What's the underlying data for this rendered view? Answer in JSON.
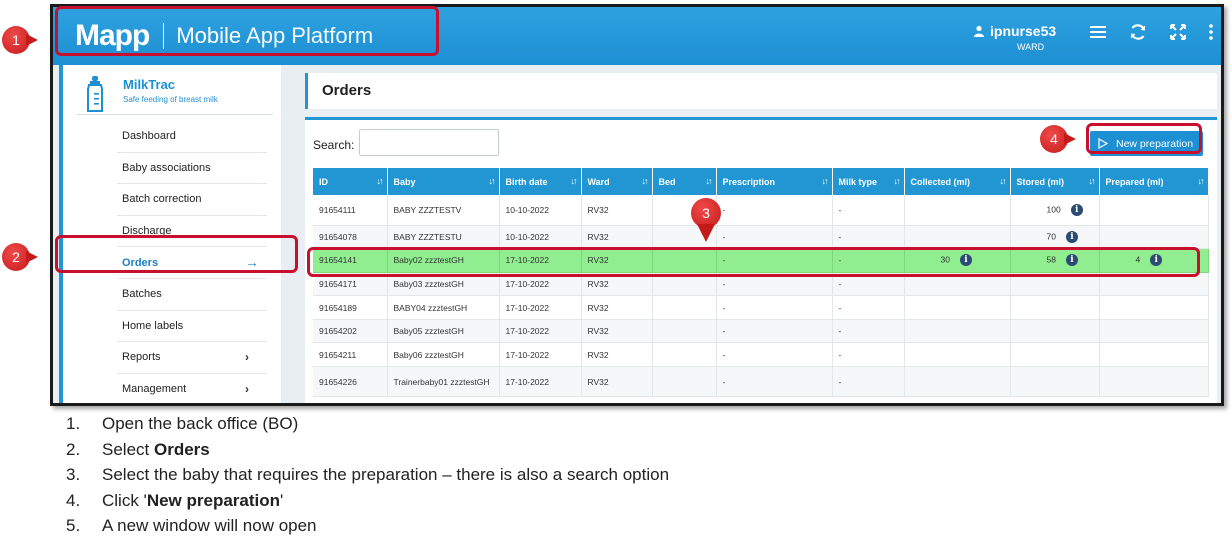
{
  "header": {
    "logo": "Mapp",
    "platform_name": "Mobile",
    "platform_name_rest": "App Platform",
    "user_name": "ipnurse53",
    "user_role": "WARD",
    "icons": [
      "person-icon",
      "menu-icon",
      "refresh-icon",
      "fullscreen-icon",
      "more-vertical-icon"
    ]
  },
  "sidebar": {
    "app_title": "MilkTrac",
    "app_subtitle": "Safe feeding of breast milk",
    "items": [
      {
        "label": "Dashboard"
      },
      {
        "label": "Baby associations"
      },
      {
        "label": "Batch correction"
      },
      {
        "label": "Discharge"
      },
      {
        "label": "Orders",
        "active": true
      },
      {
        "label": "Batches"
      },
      {
        "label": "Home labels"
      },
      {
        "label": "Reports",
        "has_submenu": true
      },
      {
        "label": "Management",
        "has_submenu": true
      }
    ]
  },
  "main": {
    "page_title": "Orders",
    "search_label": "Search:",
    "search_value": "",
    "new_preparation_label": "New preparation",
    "columns": [
      "ID",
      "Baby",
      "Birth date",
      "Ward",
      "Bed",
      "Prescription",
      "Milk type",
      "Collected (ml)",
      "Stored (ml)",
      "Prepared (ml)"
    ],
    "rows": [
      {
        "id": "91654111",
        "baby": "BABY ZZZTESTV",
        "birth": "10-10-2022",
        "ward": "RV32",
        "bed": "",
        "prescription": "-",
        "milk": "-",
        "collected": "",
        "stored": "100",
        "prepared": ""
      },
      {
        "id": "91654078",
        "baby": "BABY ZZZTESTU",
        "birth": "10-10-2022",
        "ward": "RV32",
        "bed": "",
        "prescription": "-",
        "milk": "-",
        "collected": "",
        "stored": "70",
        "prepared": ""
      },
      {
        "id": "91654141",
        "baby": "Baby02 zzztestGH",
        "birth": "17-10-2022",
        "ward": "RV32",
        "bed": "",
        "prescription": "-",
        "milk": "-",
        "collected": "30",
        "stored": "58",
        "prepared": "4",
        "selected": true
      },
      {
        "id": "91654171",
        "baby": "Baby03 zzztestGH",
        "birth": "17-10-2022",
        "ward": "RV32",
        "bed": "",
        "prescription": "-",
        "milk": "-",
        "collected": "",
        "stored": "",
        "prepared": ""
      },
      {
        "id": "91654189",
        "baby": "BABY04 zzztestGH",
        "birth": "17-10-2022",
        "ward": "RV32",
        "bed": "",
        "prescription": "-",
        "milk": "-",
        "collected": "",
        "stored": "",
        "prepared": ""
      },
      {
        "id": "91654202",
        "baby": "Baby05 zzztestGH",
        "birth": "17-10-2022",
        "ward": "RV32",
        "bed": "",
        "prescription": "-",
        "milk": "-",
        "collected": "",
        "stored": "",
        "prepared": ""
      },
      {
        "id": "91654211",
        "baby": "Baby06 zzztestGH",
        "birth": "17-10-2022",
        "ward": "RV32",
        "bed": "",
        "prescription": "-",
        "milk": "-",
        "collected": "",
        "stored": "",
        "prepared": ""
      },
      {
        "id": "91654226",
        "baby": "Trainerbaby01 zzztestGH",
        "birth": "17-10-2022",
        "ward": "RV32",
        "bed": "",
        "prescription": "-",
        "milk": "-",
        "collected": "",
        "stored": "",
        "prepared": ""
      }
    ]
  },
  "annotations": {
    "markers": [
      "1",
      "2",
      "3",
      "4"
    ],
    "accent_color": "#c8102e"
  },
  "instructions": [
    {
      "num": "1.",
      "parts": [
        {
          "text": "Open the back office (BO)",
          "bold": false
        }
      ]
    },
    {
      "num": "2.",
      "parts": [
        {
          "text": "Select ",
          "bold": false
        },
        {
          "text": "Orders",
          "bold": true
        }
      ]
    },
    {
      "num": "3.",
      "parts": [
        {
          "text": "Select the baby that requires the preparation – there is also a search option",
          "bold": false
        }
      ]
    },
    {
      "num": "4.",
      "parts": [
        {
          "text": "Click '",
          "bold": false
        },
        {
          "text": "New preparation",
          "bold": true
        },
        {
          "text": "'",
          "bold": false
        }
      ]
    },
    {
      "num": "5.",
      "parts": [
        {
          "text": "A new window will now open",
          "bold": false
        }
      ]
    }
  ],
  "colors": {
    "topbar": "#1d8fd3",
    "table_header": "#2196d3",
    "selected_row": "#90ee90",
    "info_icon": "#2b4b73"
  }
}
